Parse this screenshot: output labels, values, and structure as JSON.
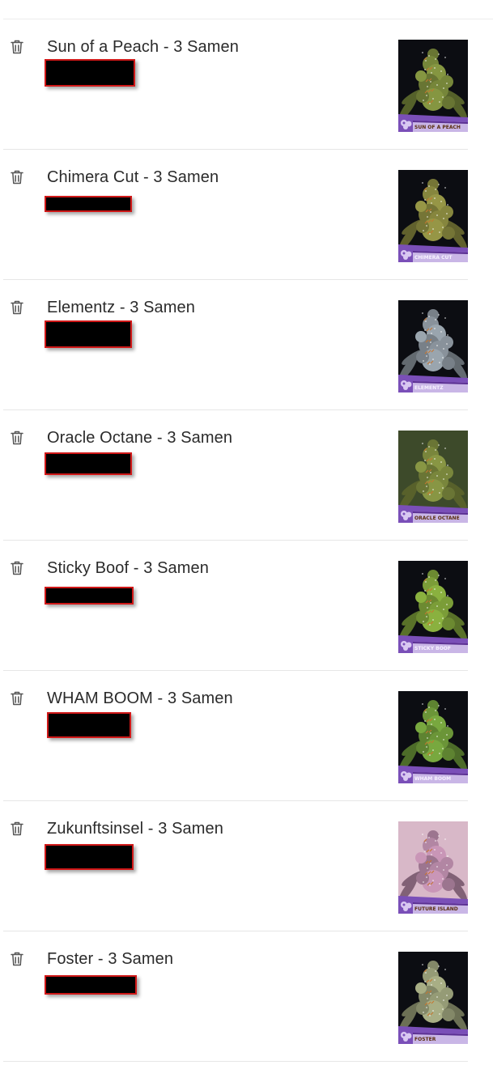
{
  "colors": {
    "brand_purple": "#7a4fb8",
    "lavender": "#c9b6e6",
    "redaction_border": "#d01818"
  },
  "cart": {
    "items": [
      {
        "title": "Sun of a Peach - 3 Samen",
        "image_label": "SUN OF A PEACH",
        "plant_hue": "#7a8a3c",
        "bg": "#0c0d12",
        "label_color": "#f3c640"
      },
      {
        "title": "Chimera Cut - 3 Samen",
        "image_label": "CHIMERA CUT",
        "plant_hue": "#8a8a40",
        "bg": "#0c0d12",
        "label_color": "#ffffff"
      },
      {
        "title": "Elementz - 3 Samen",
        "image_label": "ELEMENTZ",
        "plant_hue": "#8d97a0",
        "bg": "#0c0d12",
        "label_color": "#ffffff"
      },
      {
        "title": "Oracle Octane - 3 Samen",
        "image_label": "ORACLE OCTANE",
        "plant_hue": "#7d8a3e",
        "bg": "#3d4a2a",
        "label_color": "#f3c640"
      },
      {
        "title": "Sticky Boof - 3 Samen",
        "image_label": "STICKY BOOF",
        "plant_hue": "#7fa23a",
        "bg": "#0c0d12",
        "label_color": "#ffffff"
      },
      {
        "title": "WHAM BOOM - 3 Samen",
        "image_label": "WHAM BOOM",
        "plant_hue": "#6e9a3a",
        "bg": "#0c0d12",
        "label_color": "#ffffff"
      },
      {
        "title": "Zukunftsinsel - 3 Samen",
        "image_label": "FUTURE ISLAND",
        "plant_hue": "#b88aa8",
        "bg": "#d8b8c8",
        "label_color": "#f3c640"
      },
      {
        "title": "Foster - 3 Samen",
        "image_label": "FOSTER",
        "plant_hue": "#9aa07a",
        "bg": "#0c0d12",
        "label_color": "#f3c640"
      }
    ]
  }
}
